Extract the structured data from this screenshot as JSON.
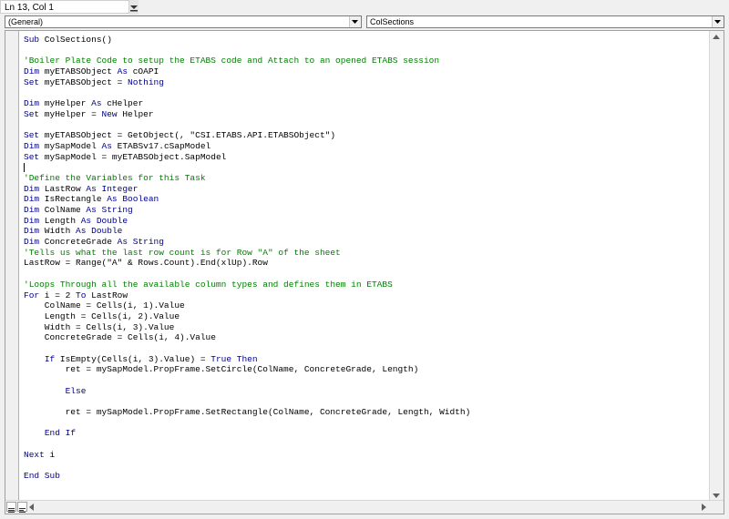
{
  "status": {
    "position": "Ln 13, Col 1"
  },
  "selectors": {
    "object": "(General)",
    "procedure": "ColSections"
  },
  "colors": {
    "keyword": "#00008b",
    "comment": "#008000",
    "text": "#000000"
  },
  "code_lines": [
    [
      {
        "t": "",
        "c": "n"
      },
      {
        "t": "Sub",
        "c": "k"
      },
      {
        "t": " ColSections()",
        "c": "n"
      }
    ],
    [],
    [
      {
        "t": "'Boiler Plate Code to setup the ETABS code and Attach to an opened ETABS session",
        "c": "c"
      }
    ],
    [
      {
        "t": "Dim",
        "c": "k"
      },
      {
        "t": " myETABSObject ",
        "c": "n"
      },
      {
        "t": "As",
        "c": "k"
      },
      {
        "t": " cOAPI",
        "c": "n"
      }
    ],
    [
      {
        "t": "Set",
        "c": "k"
      },
      {
        "t": " myETABSObject = ",
        "c": "n"
      },
      {
        "t": "Nothing",
        "c": "k"
      }
    ],
    [],
    [
      {
        "t": "Dim",
        "c": "k"
      },
      {
        "t": " myHelper ",
        "c": "n"
      },
      {
        "t": "As",
        "c": "k"
      },
      {
        "t": " cHelper",
        "c": "n"
      }
    ],
    [
      {
        "t": "Set",
        "c": "k"
      },
      {
        "t": " myHelper = ",
        "c": "n"
      },
      {
        "t": "New",
        "c": "k"
      },
      {
        "t": " Helper",
        "c": "n"
      }
    ],
    [],
    [
      {
        "t": "Set",
        "c": "k"
      },
      {
        "t": " myETABSObject = GetObject(, \"CSI.ETABS.API.ETABSObject\")",
        "c": "n"
      }
    ],
    [
      {
        "t": "Dim",
        "c": "k"
      },
      {
        "t": " mySapModel ",
        "c": "n"
      },
      {
        "t": "As",
        "c": "k"
      },
      {
        "t": " ETABSv17.cSapModel",
        "c": "n"
      }
    ],
    [
      {
        "t": "Set",
        "c": "k"
      },
      {
        "t": " mySapModel = myETABSObject.SapModel",
        "c": "n"
      }
    ],
    [
      {
        "t": "|",
        "c": "cur"
      }
    ],
    [
      {
        "t": "'Define the Variables for this Task",
        "c": "c"
      }
    ],
    [
      {
        "t": "Dim",
        "c": "k"
      },
      {
        "t": " LastRow ",
        "c": "n"
      },
      {
        "t": "As Integer",
        "c": "k"
      }
    ],
    [
      {
        "t": "Dim",
        "c": "k"
      },
      {
        "t": " IsRectangle ",
        "c": "n"
      },
      {
        "t": "As Boolean",
        "c": "k"
      }
    ],
    [
      {
        "t": "Dim",
        "c": "k"
      },
      {
        "t": " ColName ",
        "c": "n"
      },
      {
        "t": "As String",
        "c": "k"
      }
    ],
    [
      {
        "t": "Dim",
        "c": "k"
      },
      {
        "t": " Length ",
        "c": "n"
      },
      {
        "t": "As Double",
        "c": "k"
      }
    ],
    [
      {
        "t": "Dim",
        "c": "k"
      },
      {
        "t": " Width ",
        "c": "n"
      },
      {
        "t": "As Double",
        "c": "k"
      }
    ],
    [
      {
        "t": "Dim",
        "c": "k"
      },
      {
        "t": " ConcreteGrade ",
        "c": "n"
      },
      {
        "t": "As String",
        "c": "k"
      }
    ],
    [
      {
        "t": "'Tells us what the last row count is for Row \"A\" of the sheet",
        "c": "c"
      }
    ],
    [
      {
        "t": "LastRow = Range(\"A\" & Rows.Count).End(xlUp).Row",
        "c": "n"
      }
    ],
    [],
    [
      {
        "t": "'Loops Through all the available column types and defines them in ETABS",
        "c": "c"
      }
    ],
    [
      {
        "t": "For",
        "c": "k"
      },
      {
        "t": " i = 2 ",
        "c": "n"
      },
      {
        "t": "To",
        "c": "k"
      },
      {
        "t": " LastRow",
        "c": "n"
      }
    ],
    [
      {
        "t": "    ColName = Cells(i, 1).Value",
        "c": "n"
      }
    ],
    [
      {
        "t": "    Length = Cells(i, 2).Value",
        "c": "n"
      }
    ],
    [
      {
        "t": "    Width = Cells(i, 3).Value",
        "c": "n"
      }
    ],
    [
      {
        "t": "    ConcreteGrade = Cells(i, 4).Value",
        "c": "n"
      }
    ],
    [],
    [
      {
        "t": "    ",
        "c": "n"
      },
      {
        "t": "If",
        "c": "k"
      },
      {
        "t": " IsEmpty(Cells(i, 3).Value) = ",
        "c": "n"
      },
      {
        "t": "True Then",
        "c": "k"
      }
    ],
    [
      {
        "t": "        ret = mySapModel.PropFrame.SetCircle(ColName, ConcreteGrade, Length)",
        "c": "n"
      }
    ],
    [],
    [
      {
        "t": "        ",
        "c": "n"
      },
      {
        "t": "Else",
        "c": "k"
      }
    ],
    [],
    [
      {
        "t": "        ret = mySapModel.PropFrame.SetRectangle(ColName, ConcreteGrade, Length, Width)",
        "c": "n"
      }
    ],
    [],
    [
      {
        "t": "    ",
        "c": "n"
      },
      {
        "t": "End If",
        "c": "k"
      }
    ],
    [],
    [
      {
        "t": "Next",
        "c": "k"
      },
      {
        "t": " i",
        "c": "n"
      }
    ],
    [],
    [
      {
        "t": "End Sub",
        "c": "k"
      }
    ]
  ]
}
